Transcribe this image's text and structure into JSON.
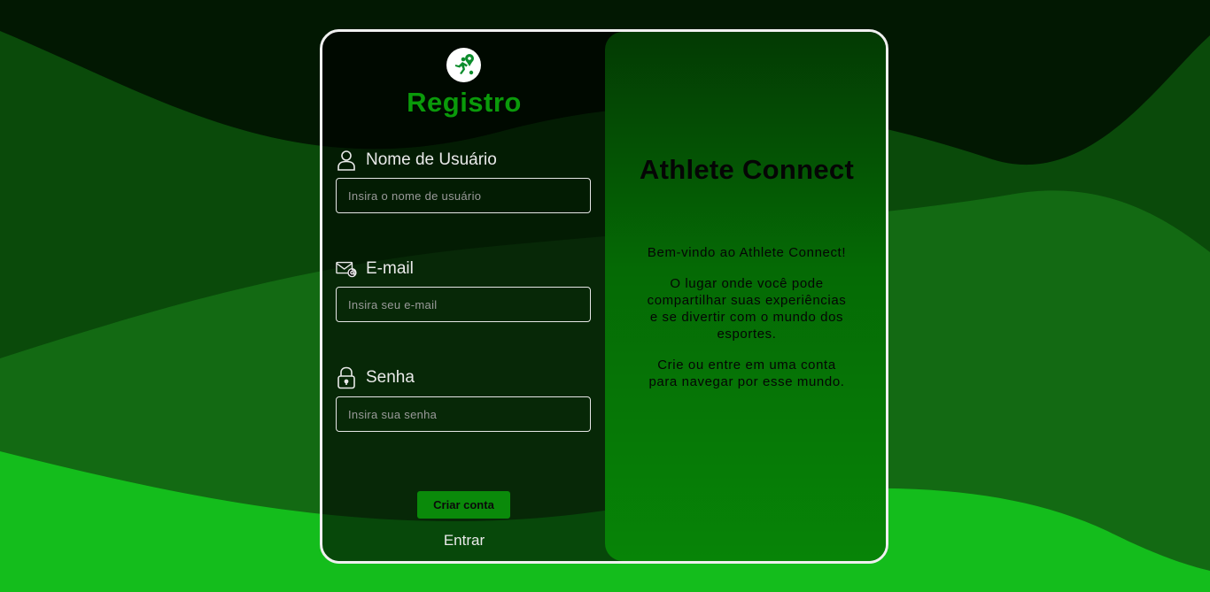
{
  "colors": {
    "accent": "#0a9a0a",
    "button": "#0a8a0a",
    "card_border": "#f0f0f0"
  },
  "register": {
    "title": "Registro",
    "logo_icon": "runner-location-icon",
    "username": {
      "label": "Nome de Usuário",
      "icon": "user-icon",
      "placeholder": "Insira o nome de usuário",
      "value": ""
    },
    "email": {
      "label": "E-mail",
      "icon": "mail-at-icon",
      "placeholder": "Insira seu e-mail",
      "value": ""
    },
    "password": {
      "label": "Senha",
      "icon": "lock-icon",
      "placeholder": "Insira sua senha",
      "value": ""
    },
    "submit_label": "Criar conta",
    "login_label": "Entrar"
  },
  "info": {
    "title": "Athlete Connect",
    "paragraphs": [
      "Bem-vindo ao Athlete Connect!",
      "O lugar onde você pode compartilhar suas experiências e se divertir com o mundo dos esportes.",
      "Crie ou entre em uma conta para navegar por esse mundo."
    ]
  }
}
